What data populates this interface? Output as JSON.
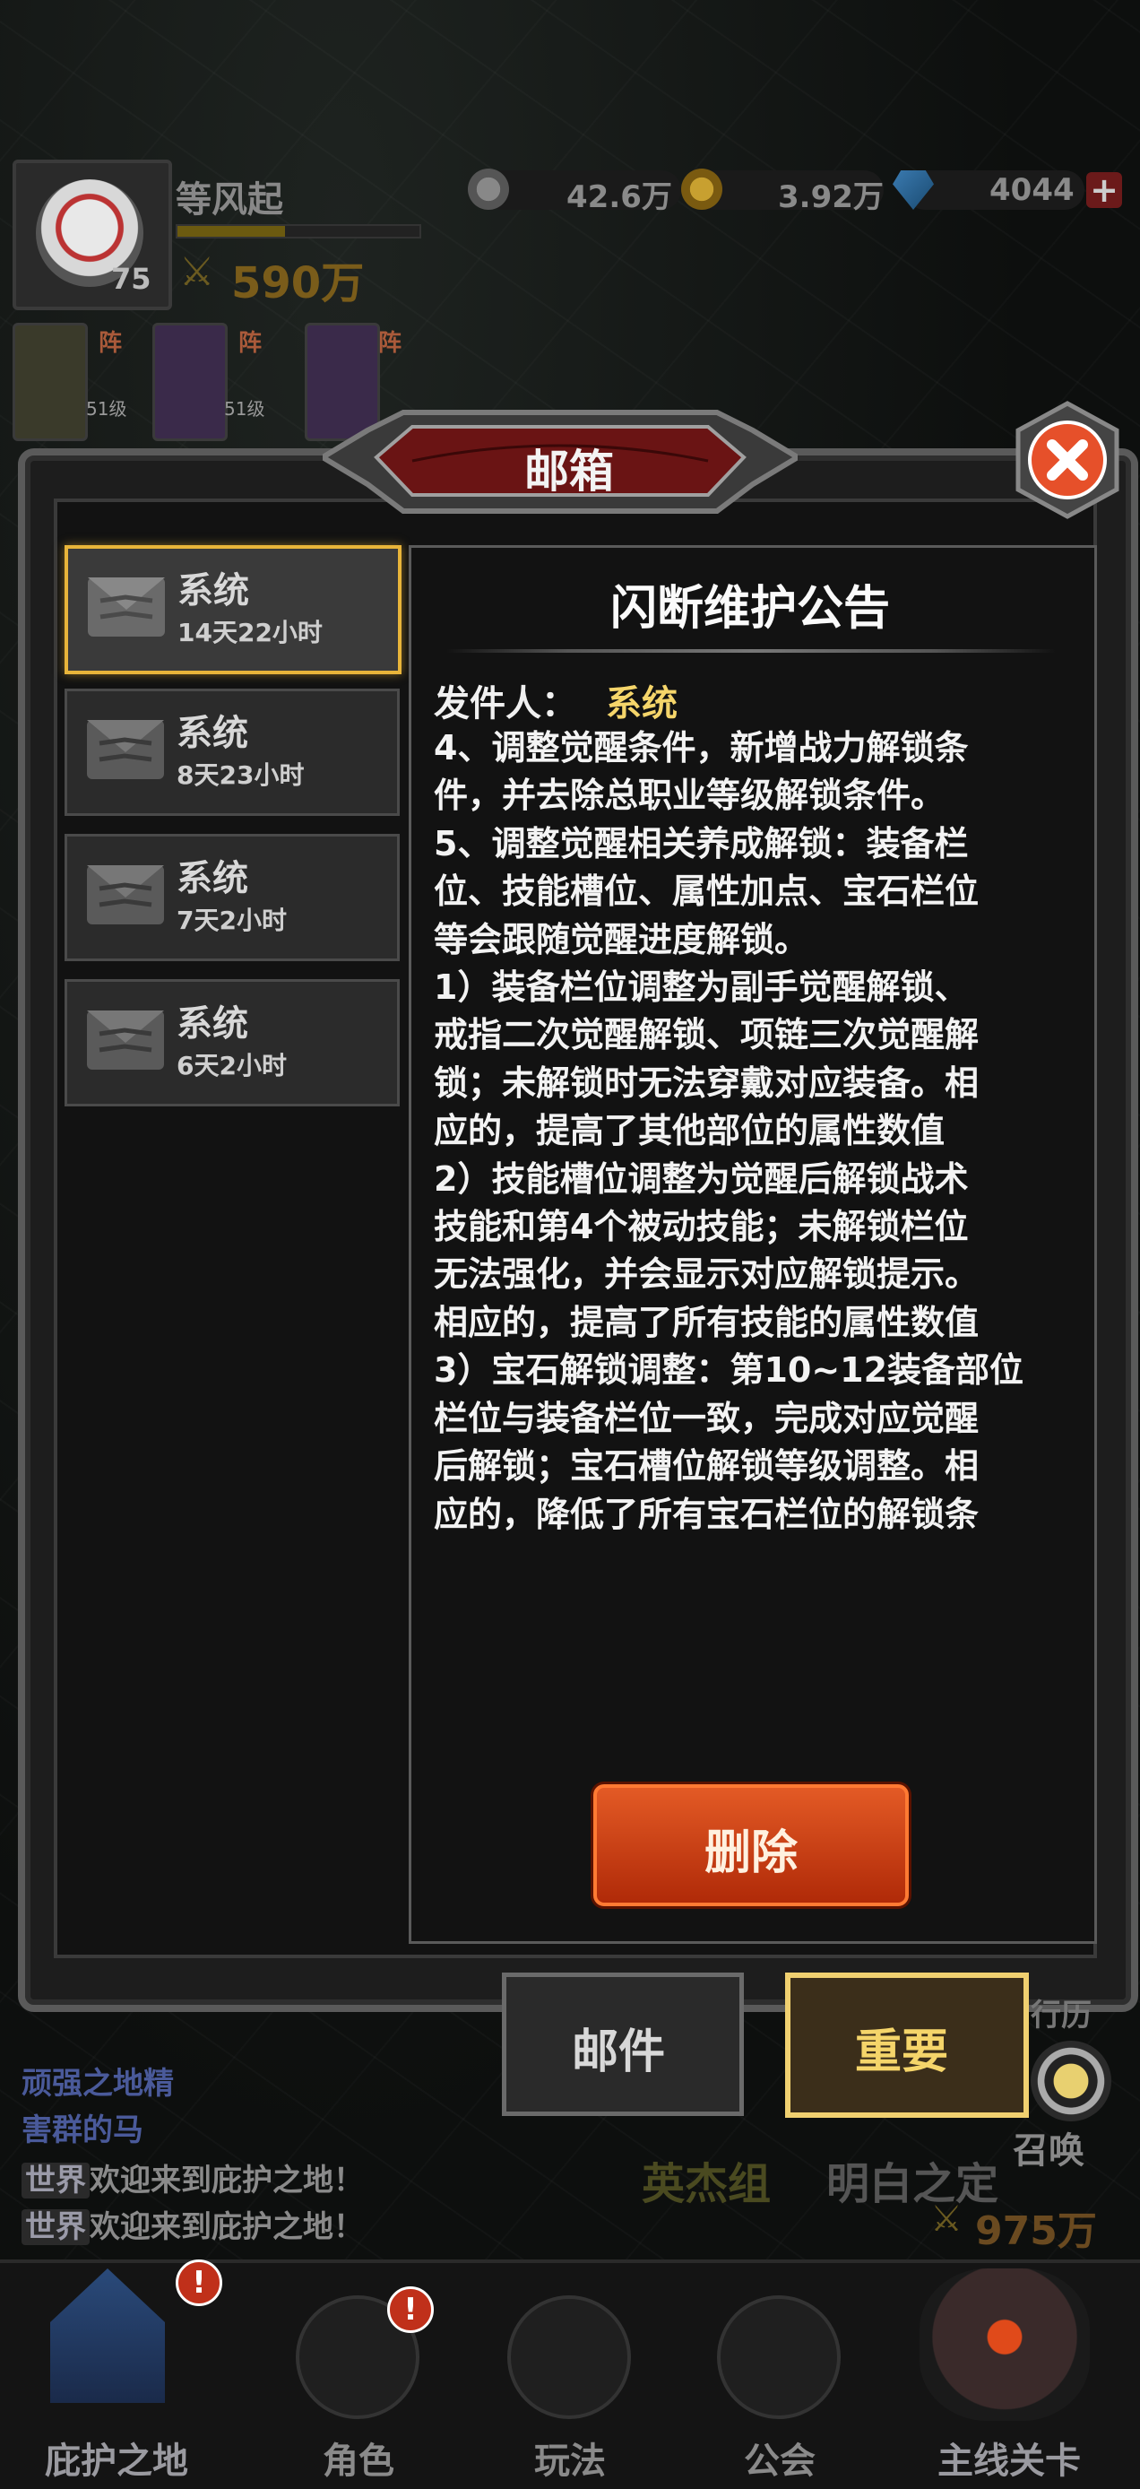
{
  "header": {
    "player_name": "等风起",
    "level": "75",
    "power": "590万",
    "resources": [
      {
        "icon": "silver-coin-icon",
        "value": "42.6万"
      },
      {
        "icon": "gold-coin-icon",
        "value": "3.92万"
      },
      {
        "icon": "diamond-icon",
        "value": "4044"
      }
    ],
    "add_label": "+"
  },
  "formation": [
    {
      "tag": "阵",
      "level": "51级"
    },
    {
      "tag": "阵",
      "level": "51级"
    },
    {
      "tag": "阵",
      "level": ""
    }
  ],
  "dialog": {
    "title": "邮箱",
    "mails": [
      {
        "from": "系统",
        "time": "14天22小时"
      },
      {
        "from": "系统",
        "time": "8天23小时"
      },
      {
        "from": "系统",
        "time": "7天2小时"
      },
      {
        "from": "系统",
        "time": "6天2小时"
      }
    ],
    "detail": {
      "title": "闪断维护公告",
      "sender_label": "发件人：",
      "sender": "系统",
      "body": "4、调整觉醒条件，新增战力解锁条\n件，并去除总职业等级解锁条件。\n5、调整觉醒相关养成解锁：装备栏\n位、技能槽位、属性加点、宝石栏位\n等会跟随觉醒进度解锁。\n1）装备栏位调整为副手觉醒解锁、\n戒指二次觉醒解锁、项链三次觉醒解\n锁；未解锁时无法穿戴对应装备。相\n应的，提高了其他部位的属性数值\n2）技能槽位调整为觉醒后解锁战术\n技能和第4个被动技能；未解锁栏位\n无法强化，并会显示对应解锁提示。\n相应的，提高了所有技能的属性数值\n3）宝石解锁调整：第10~12装备部位\n栏位与装备栏位一致，完成对应觉醒\n后解锁；宝石槽位解锁等级调整。相\n应的，降低了所有宝石栏位的解锁条",
      "delete_label": "删除"
    },
    "tabs": [
      {
        "label": "邮件",
        "active": false
      },
      {
        "label": "重要",
        "active": true
      }
    ]
  },
  "side": {
    "right_label_1": "行历",
    "summon_label": "召唤",
    "hero_label": "英杰组",
    "hero_name": "明白之定",
    "hero_power": "975万"
  },
  "chat": {
    "lines": [
      {
        "prefix": "",
        "text": "顽强之地精"
      },
      {
        "prefix": "",
        "text": "害群的马"
      },
      {
        "prefix": "世界",
        "text": "欢迎来到庇护之地！"
      },
      {
        "prefix": "世界",
        "text": "欢迎来到庇护之地！"
      }
    ]
  },
  "nav": [
    {
      "label": "庇护之地",
      "icon": "castle-icon",
      "badge": "!"
    },
    {
      "label": "角色",
      "icon": "character-icon",
      "badge": "!"
    },
    {
      "label": "玩法",
      "icon": "gameplay-icon",
      "badge": ""
    },
    {
      "label": "公会",
      "icon": "guild-icon",
      "badge": ""
    },
    {
      "label": "主线关卡",
      "icon": "main-stage-icon",
      "badge": ""
    }
  ],
  "colors": {
    "accent_gold": "#f5d56a",
    "delete_orange": "#d8441a",
    "close_red": "#e6502a",
    "selected_border": "#e8b43a"
  }
}
